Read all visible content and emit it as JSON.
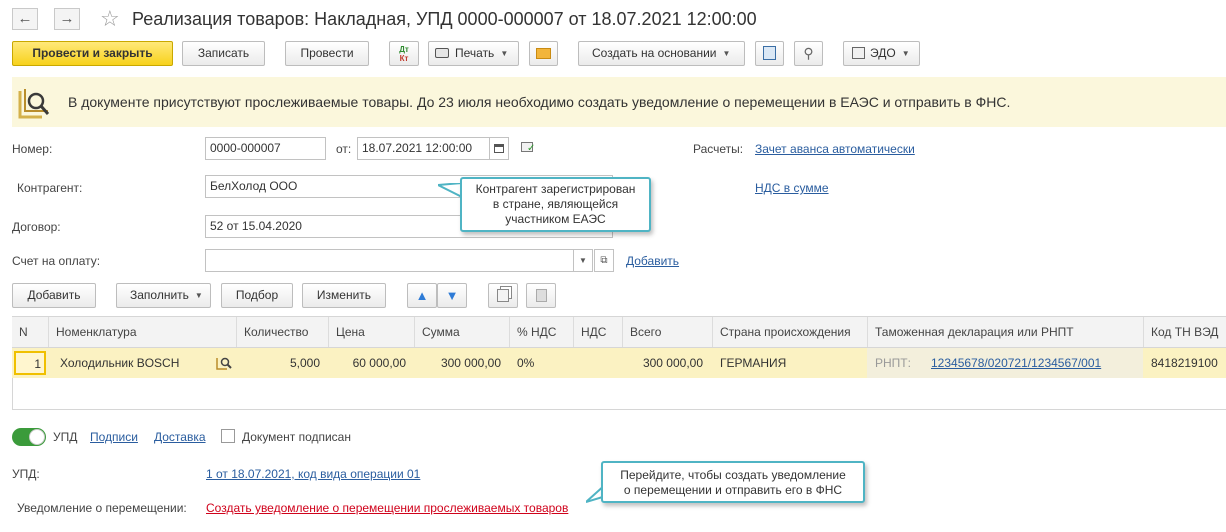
{
  "window": {
    "title": "Реализация товаров: Накладная, УПД 0000-000007 от 18.07.2021 12:00:00",
    "back_glyph": "←",
    "forward_glyph": "→",
    "star_glyph": "☆"
  },
  "toolbar": {
    "post_close": "Провести и закрыть",
    "save": "Записать",
    "post": "Провести",
    "dtkt_top": "Дт",
    "dtkt_bottom": "Кт",
    "print": "Печать",
    "create_based": "Создать на основании",
    "edo": "ЭДО"
  },
  "banner": {
    "text": "В документе присутствуют прослеживаемые товары. До 23 июля необходимо создать уведомление о перемещении в ЕАЭС и отправить в ФНС."
  },
  "form": {
    "number_label": "Номер:",
    "number_value": "0000-000007",
    "date_label": "от:",
    "date_value": "18.07.2021 12:00:00",
    "settlements_label": "Расчеты:",
    "settlements_link": "Зачет аванса автоматически",
    "vat_link": "НДС в сумме",
    "counterparty_label": "Контрагент:",
    "counterparty_value": "БелХолод ООО",
    "contract_label": "Договор:",
    "contract_value": "52 от 15.04.2020",
    "invoice_label": "Счет на оплату:",
    "invoice_value": "",
    "add_link": "Добавить"
  },
  "tooltips": {
    "counterparty": [
      "Контрагент зарегистрирован",
      "в стране, являющейся",
      "участником ЕАЭС"
    ],
    "notification": [
      "Перейдите, чтобы создать уведомление",
      "о перемещении и отправить его в ФНС"
    ]
  },
  "table_toolbar": {
    "add": "Добавить",
    "fill": "Заполнить",
    "selection": "Подбор",
    "change": "Изменить"
  },
  "table": {
    "columns": [
      "N",
      "Номенклатура",
      "Количество",
      "Цена",
      "Сумма",
      "% НДС",
      "НДС",
      "Всего",
      "Страна происхождения",
      "Таможенная декларация или РНПТ",
      "Код ТН ВЭД"
    ],
    "rows": [
      {
        "n": "1",
        "item": "Холодильник BOSCH",
        "qty": "5,000",
        "price": "60 000,00",
        "sum": "300 000,00",
        "vat_rate": "0%",
        "vat": "",
        "total": "300 000,00",
        "country": "ГЕРМАНИЯ",
        "rnpt_label": "РНПТ:",
        "rnpt_value": "12345678/020721/1234567/001",
        "tnved": "8418219100"
      }
    ]
  },
  "footer": {
    "upd_toggle_label": "УПД",
    "signatures_link": "Подписи",
    "delivery_link": "Доставка",
    "signed_checkbox_label": "Документ подписан",
    "upd_label": "УПД:",
    "upd_link": "1 от 18.07.2021, код вида операции 01",
    "notification_label": "Уведомление о перемещении:",
    "notification_link": "Создать уведомление о перемещении прослеживаемых товаров"
  },
  "colors": {
    "primary_button": "#f7d21c",
    "banner_bg": "#fbf7dc",
    "selected_row": "#fbf2c2",
    "link": "#2a5d9f",
    "red_link": "#d0021b",
    "tooltip_border": "#4fb4c4",
    "toggle_on": "#3b9b3b"
  }
}
